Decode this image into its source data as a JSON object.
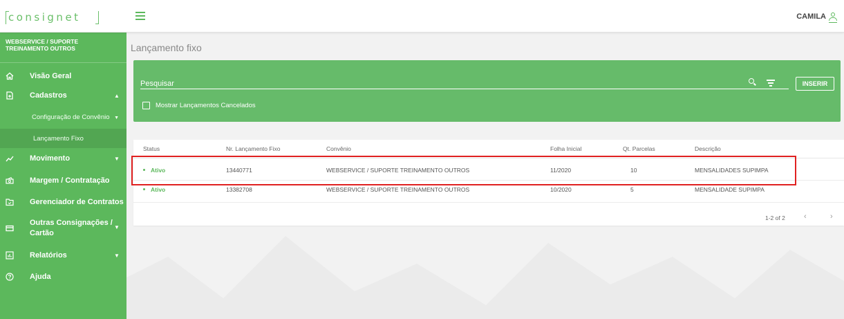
{
  "brand": {
    "logo_text": "consignet",
    "accent": "#5cb85c"
  },
  "header": {
    "user_name": "CAMILA"
  },
  "sidebar": {
    "org_line1": "WEBSERVICE / SUPORTE",
    "org_line2": "TREINAMENTO OUTROS",
    "items": [
      {
        "label": "Visão Geral",
        "icon": "home-icon"
      },
      {
        "label": "Cadastros",
        "icon": "document-icon",
        "expanded": true
      },
      {
        "label": "Configuração de Convênio",
        "sub": true
      },
      {
        "label": "Lançamento Fixo",
        "sub": true,
        "active": true
      },
      {
        "label": "Movimento",
        "icon": "trend-icon"
      },
      {
        "label": "Margem / Contratação",
        "icon": "money-icon"
      },
      {
        "label": "Gerenciador de Contratos",
        "icon": "folder-icon"
      },
      {
        "label": "Outras Consignações /",
        "label2": "Cartão",
        "icon": "card-icon"
      },
      {
        "label": "Relatórios",
        "icon": "report-icon"
      },
      {
        "label": "Ajuda",
        "icon": "help-icon"
      }
    ]
  },
  "main": {
    "title": "Lançamento fixo",
    "search_placeholder": "Pesquisar",
    "insert_label": "INSERIR",
    "show_cancelled_label": "Mostrar Lançamentos Cancelados",
    "columns": [
      "Status",
      "Nr. Lançamento Fixo",
      "Convênio",
      "Folha Inicial",
      "Qt. Parcelas",
      "Descrição"
    ],
    "rows": [
      {
        "status": "Ativo",
        "number": "13440771",
        "convenio": "WEBSERVICE / SUPORTE TREINAMENTO OUTROS",
        "folha": "11/2020",
        "parcelas": "10",
        "descricao": "MENSALIDADES SUPIMPA"
      },
      {
        "status": "Ativo",
        "number": "13382708",
        "convenio": "WEBSERVICE / SUPORTE TREINAMENTO OUTROS",
        "folha": "10/2020",
        "parcelas": "5",
        "descricao": "MENSALIDADE SUPIMPA"
      }
    ],
    "pagination": "1-2 of 2"
  }
}
